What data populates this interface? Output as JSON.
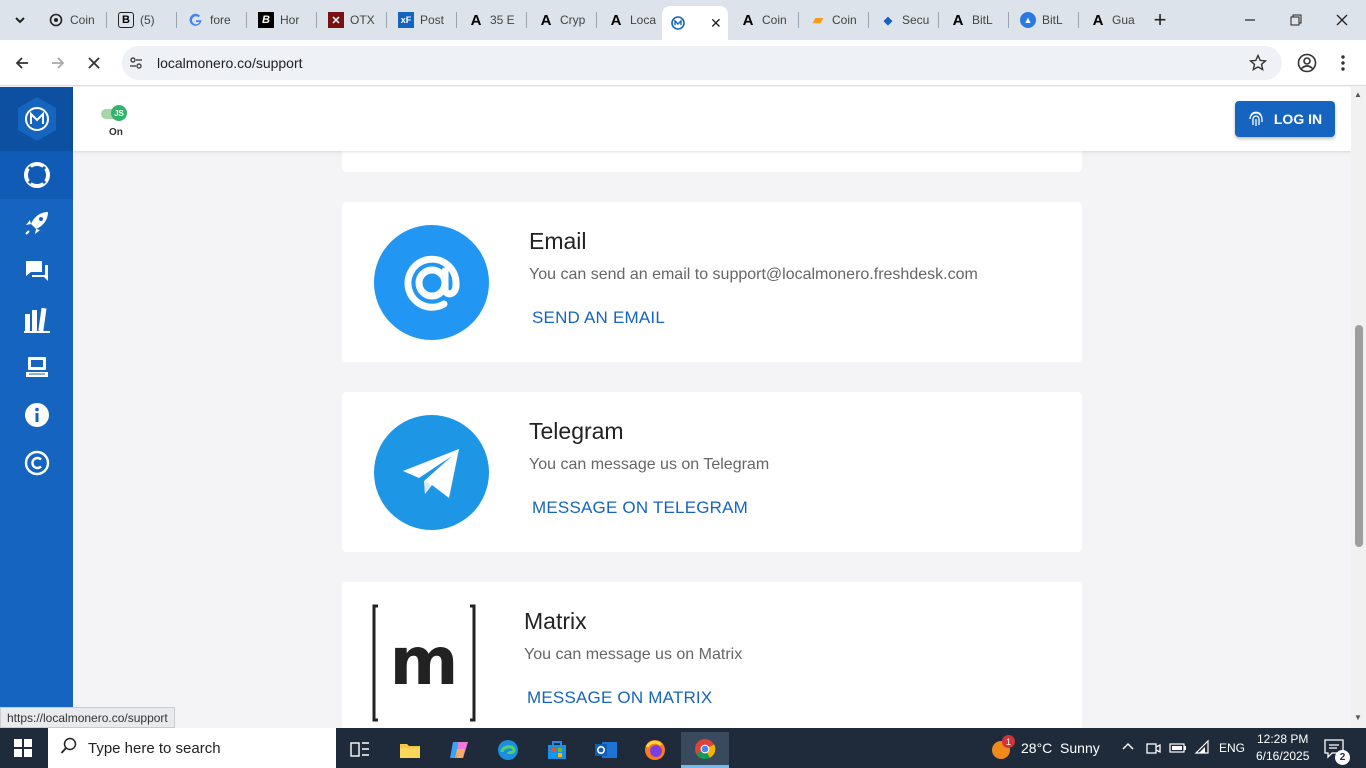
{
  "browser": {
    "tabs": [
      {
        "title": "Coin",
        "icon": "openai-icon"
      },
      {
        "title": "(5)",
        "icon": "b-logo-icon"
      },
      {
        "title": "fore",
        "icon": "google-icon"
      },
      {
        "title": "Hor",
        "icon": "bi-logo-icon"
      },
      {
        "title": "OTX",
        "icon": "x-logo-icon"
      },
      {
        "title": "Post",
        "icon": "xf-icon"
      },
      {
        "title": "35 E",
        "icon": "a-logo-icon"
      },
      {
        "title": "Cryp",
        "icon": "a-logo-icon"
      },
      {
        "title": "Loca",
        "icon": "a-logo-icon"
      },
      {
        "title": "",
        "icon": "localmonero-icon",
        "active": true
      },
      {
        "title": "Coin",
        "icon": "a-logo-icon"
      },
      {
        "title": "Coin",
        "icon": "coin-icon"
      },
      {
        "title": "Secu",
        "icon": "shield-icon"
      },
      {
        "title": "BitL",
        "icon": "a-logo-icon"
      },
      {
        "title": "BitL",
        "icon": "bitlocker-icon"
      },
      {
        "title": "Gua",
        "icon": "a-logo-icon"
      }
    ],
    "url": "localmonero.co/support",
    "status_url": "https://localmonero.co/support"
  },
  "site": {
    "js_badge": "JS",
    "js_label": "On",
    "login_label": "LOG IN",
    "sidebar_icons": [
      "support-icon",
      "rocket-icon",
      "chat-icon",
      "guides-icon",
      "terminal-icon",
      "info-icon",
      "copyright-icon"
    ]
  },
  "contacts": [
    {
      "title": "Email",
      "desc": "You can send an email to support@localmonero.freshdesk.com",
      "link": "SEND AN EMAIL"
    },
    {
      "title": "Telegram",
      "desc": "You can message us on Telegram",
      "link": "MESSAGE ON TELEGRAM"
    },
    {
      "title": "Matrix",
      "desc": "You can message us on Matrix",
      "link": "MESSAGE ON MATRIX"
    }
  ],
  "taskbar": {
    "search_placeholder": "Type here to search",
    "weather": "28°C  Sunny",
    "weather_badge": "1",
    "language": "ENG",
    "time": "12:28 PM",
    "date": "6/16/2025",
    "notifications": "2"
  },
  "colors": {
    "brand": "#1565c0",
    "email_circle": "#2196f3",
    "telegram_circle": "#1e96e6"
  }
}
